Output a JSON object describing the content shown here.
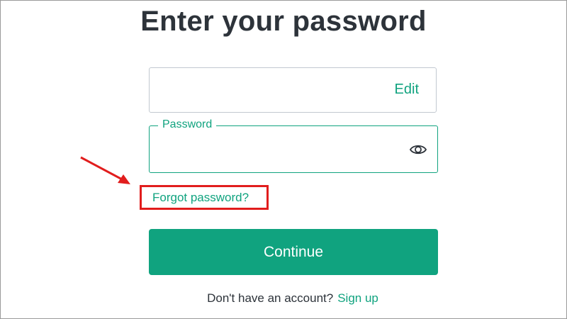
{
  "page": {
    "title": "Enter your password"
  },
  "email_field": {
    "value": "",
    "edit_label": "Edit"
  },
  "password_field": {
    "label": "Password",
    "value": "",
    "toggle_icon": "eye-icon"
  },
  "forgot_password": {
    "label": "Forgot password?",
    "highlight_color": "#e11d1d"
  },
  "continue_button": {
    "label": "Continue"
  },
  "signup": {
    "prompt": "Don't have an account?",
    "link_label": "Sign up"
  },
  "colors": {
    "accent": "#10a37f",
    "text": "#2d333a",
    "annotation": "#e11d1d",
    "border": "#c2c8d0"
  }
}
